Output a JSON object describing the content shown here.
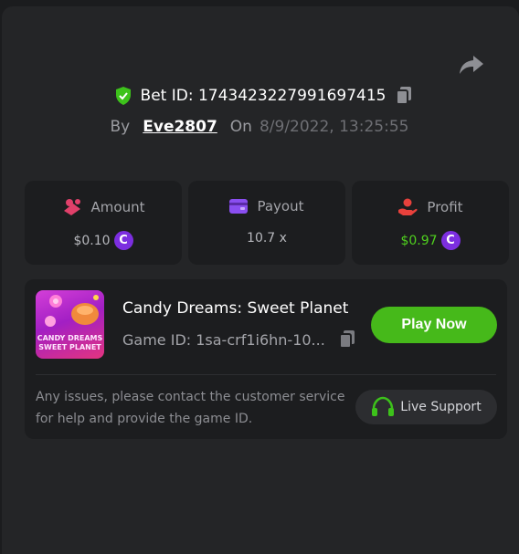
{
  "bet": {
    "id_label": "Bet ID: 1743423227991697415",
    "by_label": "By",
    "username": "Eve2807",
    "on_label": "On",
    "date": "8/9/2022, 13:25:55"
  },
  "stats": {
    "amount": {
      "label": "Amount",
      "value": "$0.10",
      "coin": "C"
    },
    "payout": {
      "label": "Payout",
      "value": "10.7 x"
    },
    "profit": {
      "label": "Profit",
      "value": "$0.97",
      "coin": "C"
    }
  },
  "game": {
    "title": "Candy Dreams: Sweet Planet",
    "game_id": "Game ID: 1sa-crf1i6hn-10...",
    "thumb_line1": "CANDY DREAMS",
    "thumb_line2": "SWEET PLANET",
    "play_label": "Play Now"
  },
  "support": {
    "help_text": "Any issues, please contact the customer service for help and provide the game ID.",
    "button_label": "Live Support"
  },
  "colors": {
    "accent_green": "#46b91a",
    "profit_green": "#4fd01e",
    "coin_purple": "#7c2ee0",
    "amount_icon": "#e0406a",
    "payout_icon": "#8a4ef0",
    "profit_icon": "#e8413c"
  },
  "icons": {
    "share": "share-arrow-icon",
    "verified": "shield-check-icon",
    "copy": "copy-icon",
    "amount": "chip-icon",
    "payout": "wallet-icon",
    "profit": "hand-coin-icon",
    "support": "headset-icon"
  }
}
